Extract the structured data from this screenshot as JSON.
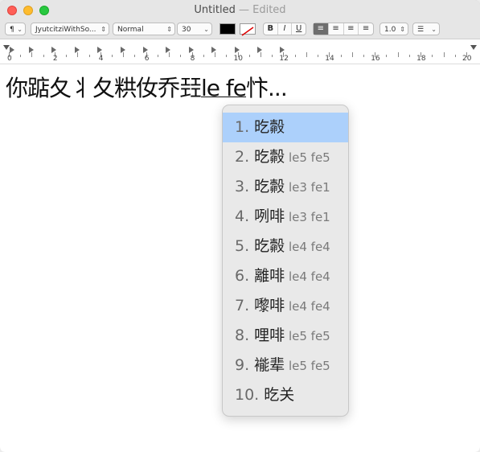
{
  "window": {
    "title": "Untitled",
    "title_suffix": " — Edited"
  },
  "toolbar": {
    "paragraph_style": "¶",
    "font_family": "JyutcitziWithSo...",
    "typeface": "Normal",
    "font_size": "30",
    "bold": "B",
    "italic": "I",
    "underline": "U",
    "line_spacing": "1.0",
    "text_color": "#000000",
    "background_color": "#ffffff"
  },
  "ruler": {
    "numbers": [
      "0",
      "2",
      "4",
      "6",
      "8",
      "10",
      "12",
      "14",
      "16",
      "18",
      "20"
    ]
  },
  "document": {
    "text_before": "你踮夂丬夂粠㚢乔㠭",
    "marked_text": "le fe",
    "text_after": "忭...",
    "full_line_note": ""
  },
  "candidates": [
    {
      "num": "1.",
      "text": "㫓㲉",
      "romanization": ""
    },
    {
      "num": "2.",
      "text": "㫓㲉",
      "romanization": "le5 fe5"
    },
    {
      "num": "3.",
      "text": "㫓㲉",
      "romanization": "le3 fe1"
    },
    {
      "num": "4.",
      "text": "咧啡",
      "romanization": "le3 fe1"
    },
    {
      "num": "5.",
      "text": "㫓㲉",
      "romanization": "le4 fe4"
    },
    {
      "num": "6.",
      "text": "離啡",
      "romanization": "le4 fe4"
    },
    {
      "num": "7.",
      "text": "嚟啡",
      "romanization": "le4 fe4"
    },
    {
      "num": "8.",
      "text": "哩啡",
      "romanization": "le5 fe5"
    },
    {
      "num": "9.",
      "text": "褦辈",
      "romanization": "le5 fe5"
    },
    {
      "num": "10.",
      "text": "㫓关",
      "romanization": ""
    }
  ],
  "selected_candidate_index": 0,
  "colors": {
    "selection": "#acd0fb",
    "close": "#ff5f57",
    "minimize": "#febc2e",
    "zoom": "#28c840"
  }
}
